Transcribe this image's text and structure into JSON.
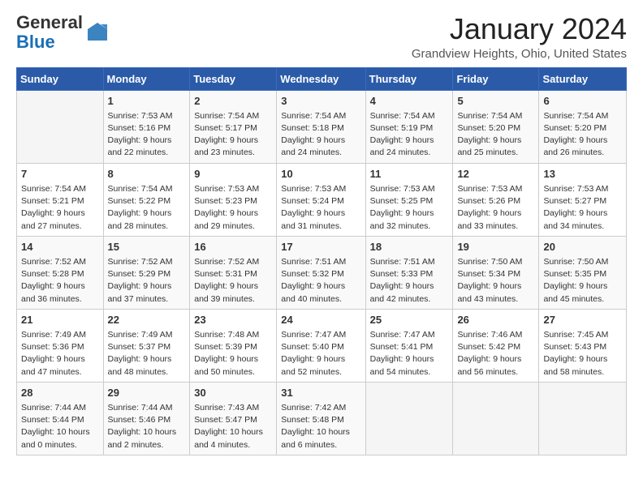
{
  "header": {
    "logo_general": "General",
    "logo_blue": "Blue",
    "month_title": "January 2024",
    "location": "Grandview Heights, Ohio, United States"
  },
  "days_of_week": [
    "Sunday",
    "Monday",
    "Tuesday",
    "Wednesday",
    "Thursday",
    "Friday",
    "Saturday"
  ],
  "weeks": [
    [
      {
        "day": "",
        "info": ""
      },
      {
        "day": "1",
        "info": "Sunrise: 7:53 AM\nSunset: 5:16 PM\nDaylight: 9 hours\nand 22 minutes."
      },
      {
        "day": "2",
        "info": "Sunrise: 7:54 AM\nSunset: 5:17 PM\nDaylight: 9 hours\nand 23 minutes."
      },
      {
        "day": "3",
        "info": "Sunrise: 7:54 AM\nSunset: 5:18 PM\nDaylight: 9 hours\nand 24 minutes."
      },
      {
        "day": "4",
        "info": "Sunrise: 7:54 AM\nSunset: 5:19 PM\nDaylight: 9 hours\nand 24 minutes."
      },
      {
        "day": "5",
        "info": "Sunrise: 7:54 AM\nSunset: 5:20 PM\nDaylight: 9 hours\nand 25 minutes."
      },
      {
        "day": "6",
        "info": "Sunrise: 7:54 AM\nSunset: 5:20 PM\nDaylight: 9 hours\nand 26 minutes."
      }
    ],
    [
      {
        "day": "7",
        "info": "Sunrise: 7:54 AM\nSunset: 5:21 PM\nDaylight: 9 hours\nand 27 minutes."
      },
      {
        "day": "8",
        "info": "Sunrise: 7:54 AM\nSunset: 5:22 PM\nDaylight: 9 hours\nand 28 minutes."
      },
      {
        "day": "9",
        "info": "Sunrise: 7:53 AM\nSunset: 5:23 PM\nDaylight: 9 hours\nand 29 minutes."
      },
      {
        "day": "10",
        "info": "Sunrise: 7:53 AM\nSunset: 5:24 PM\nDaylight: 9 hours\nand 31 minutes."
      },
      {
        "day": "11",
        "info": "Sunrise: 7:53 AM\nSunset: 5:25 PM\nDaylight: 9 hours\nand 32 minutes."
      },
      {
        "day": "12",
        "info": "Sunrise: 7:53 AM\nSunset: 5:26 PM\nDaylight: 9 hours\nand 33 minutes."
      },
      {
        "day": "13",
        "info": "Sunrise: 7:53 AM\nSunset: 5:27 PM\nDaylight: 9 hours\nand 34 minutes."
      }
    ],
    [
      {
        "day": "14",
        "info": "Sunrise: 7:52 AM\nSunset: 5:28 PM\nDaylight: 9 hours\nand 36 minutes."
      },
      {
        "day": "15",
        "info": "Sunrise: 7:52 AM\nSunset: 5:29 PM\nDaylight: 9 hours\nand 37 minutes."
      },
      {
        "day": "16",
        "info": "Sunrise: 7:52 AM\nSunset: 5:31 PM\nDaylight: 9 hours\nand 39 minutes."
      },
      {
        "day": "17",
        "info": "Sunrise: 7:51 AM\nSunset: 5:32 PM\nDaylight: 9 hours\nand 40 minutes."
      },
      {
        "day": "18",
        "info": "Sunrise: 7:51 AM\nSunset: 5:33 PM\nDaylight: 9 hours\nand 42 minutes."
      },
      {
        "day": "19",
        "info": "Sunrise: 7:50 AM\nSunset: 5:34 PM\nDaylight: 9 hours\nand 43 minutes."
      },
      {
        "day": "20",
        "info": "Sunrise: 7:50 AM\nSunset: 5:35 PM\nDaylight: 9 hours\nand 45 minutes."
      }
    ],
    [
      {
        "day": "21",
        "info": "Sunrise: 7:49 AM\nSunset: 5:36 PM\nDaylight: 9 hours\nand 47 minutes."
      },
      {
        "day": "22",
        "info": "Sunrise: 7:49 AM\nSunset: 5:37 PM\nDaylight: 9 hours\nand 48 minutes."
      },
      {
        "day": "23",
        "info": "Sunrise: 7:48 AM\nSunset: 5:39 PM\nDaylight: 9 hours\nand 50 minutes."
      },
      {
        "day": "24",
        "info": "Sunrise: 7:47 AM\nSunset: 5:40 PM\nDaylight: 9 hours\nand 52 minutes."
      },
      {
        "day": "25",
        "info": "Sunrise: 7:47 AM\nSunset: 5:41 PM\nDaylight: 9 hours\nand 54 minutes."
      },
      {
        "day": "26",
        "info": "Sunrise: 7:46 AM\nSunset: 5:42 PM\nDaylight: 9 hours\nand 56 minutes."
      },
      {
        "day": "27",
        "info": "Sunrise: 7:45 AM\nSunset: 5:43 PM\nDaylight: 9 hours\nand 58 minutes."
      }
    ],
    [
      {
        "day": "28",
        "info": "Sunrise: 7:44 AM\nSunset: 5:44 PM\nDaylight: 10 hours\nand 0 minutes."
      },
      {
        "day": "29",
        "info": "Sunrise: 7:44 AM\nSunset: 5:46 PM\nDaylight: 10 hours\nand 2 minutes."
      },
      {
        "day": "30",
        "info": "Sunrise: 7:43 AM\nSunset: 5:47 PM\nDaylight: 10 hours\nand 4 minutes."
      },
      {
        "day": "31",
        "info": "Sunrise: 7:42 AM\nSunset: 5:48 PM\nDaylight: 10 hours\nand 6 minutes."
      },
      {
        "day": "",
        "info": ""
      },
      {
        "day": "",
        "info": ""
      },
      {
        "day": "",
        "info": ""
      }
    ]
  ]
}
